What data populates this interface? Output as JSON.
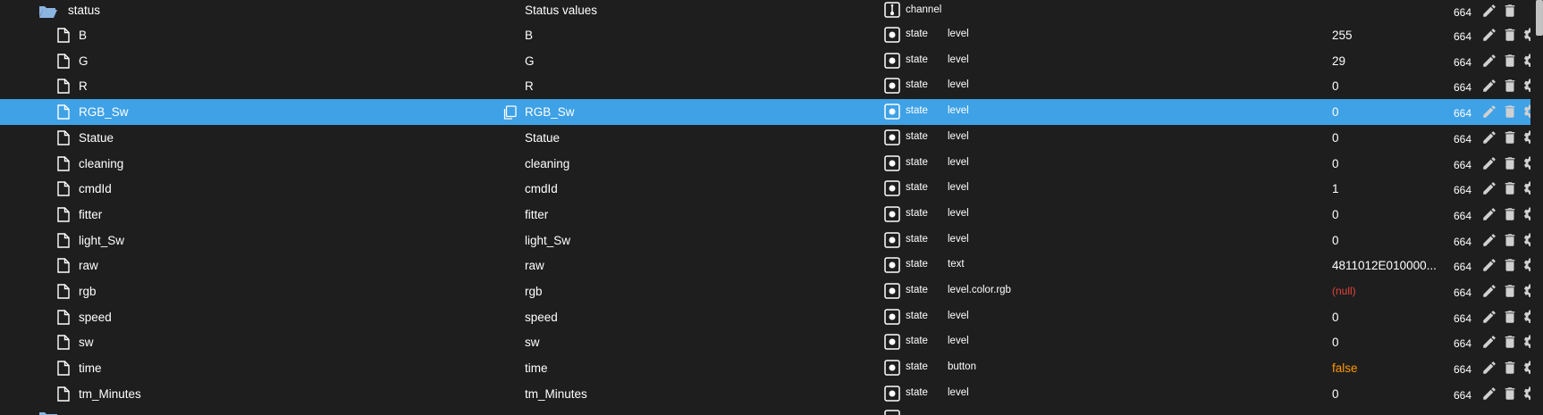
{
  "parent": {
    "name": "status",
    "title": "Status values",
    "type": "channel",
    "acl": "664"
  },
  "rows": [
    {
      "name": "B",
      "title": "B",
      "type": "state",
      "role": "level",
      "value": "255",
      "value_kind": "normal",
      "acl": "664",
      "selected": false
    },
    {
      "name": "G",
      "title": "G",
      "type": "state",
      "role": "level",
      "value": "29",
      "value_kind": "normal",
      "acl": "664",
      "selected": false
    },
    {
      "name": "R",
      "title": "R",
      "type": "state",
      "role": "level",
      "value": "0",
      "value_kind": "normal",
      "acl": "664",
      "selected": false
    },
    {
      "name": "RGB_Sw",
      "title": "RGB_Sw",
      "type": "state",
      "role": "level",
      "value": "0",
      "value_kind": "normal",
      "acl": "664",
      "selected": true
    },
    {
      "name": "Statue",
      "title": "Statue",
      "type": "state",
      "role": "level",
      "value": "0",
      "value_kind": "normal",
      "acl": "664",
      "selected": false
    },
    {
      "name": "cleaning",
      "title": "cleaning",
      "type": "state",
      "role": "level",
      "value": "0",
      "value_kind": "normal",
      "acl": "664",
      "selected": false
    },
    {
      "name": "cmdId",
      "title": "cmdId",
      "type": "state",
      "role": "level",
      "value": "1",
      "value_kind": "normal",
      "acl": "664",
      "selected": false
    },
    {
      "name": "fitter",
      "title": "fitter",
      "type": "state",
      "role": "level",
      "value": "0",
      "value_kind": "normal",
      "acl": "664",
      "selected": false
    },
    {
      "name": "light_Sw",
      "title": "light_Sw",
      "type": "state",
      "role": "level",
      "value": "0",
      "value_kind": "normal",
      "acl": "664",
      "selected": false
    },
    {
      "name": "raw",
      "title": "raw",
      "type": "state",
      "role": "text",
      "value": "4811012E010000...",
      "value_kind": "normal",
      "acl": "664",
      "selected": false
    },
    {
      "name": "rgb",
      "title": "rgb",
      "type": "state",
      "role": "level.color.rgb",
      "value": "(null)",
      "value_kind": "null",
      "acl": "664",
      "selected": false
    },
    {
      "name": "speed",
      "title": "speed",
      "type": "state",
      "role": "level",
      "value": "0",
      "value_kind": "normal",
      "acl": "664",
      "selected": false
    },
    {
      "name": "sw",
      "title": "sw",
      "type": "state",
      "role": "level",
      "value": "0",
      "value_kind": "normal",
      "acl": "664",
      "selected": false
    },
    {
      "name": "time",
      "title": "time",
      "type": "state",
      "role": "button",
      "value": "false",
      "value_kind": "bool",
      "acl": "664",
      "selected": false
    },
    {
      "name": "tm_Minutes",
      "title": "tm_Minutes",
      "type": "state",
      "role": "level",
      "value": "0",
      "value_kind": "normal",
      "acl": "664",
      "selected": false
    }
  ],
  "icons": {
    "folder": "folder-open-icon",
    "file": "file-icon",
    "copy": "copy-icon",
    "channel": "channel-icon",
    "state": "state-icon",
    "edit": "pencil-icon",
    "delete": "trash-icon",
    "settings": "gear-icon"
  },
  "colors": {
    "background": "#1e1e1e",
    "selected": "#3fa1e6",
    "null_value": "#e0433b",
    "bool_value": "#ff9800",
    "folder": "#8cb4e0"
  }
}
